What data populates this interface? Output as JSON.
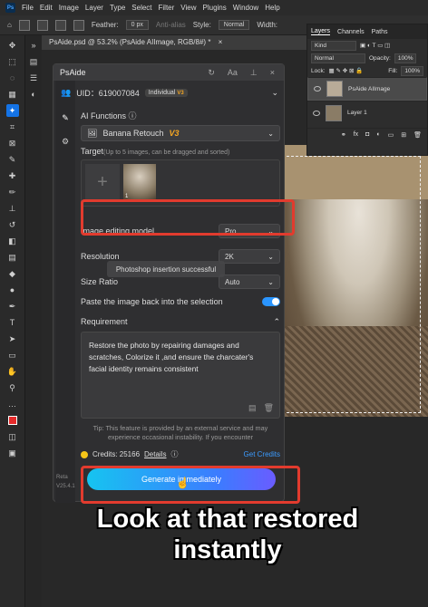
{
  "menubar": {
    "logo": "Ps",
    "items": [
      "File",
      "Edit",
      "Image",
      "Layer",
      "Type",
      "Select",
      "Filter",
      "View",
      "Plugins",
      "Window",
      "Help"
    ]
  },
  "options": {
    "feather_label": "Feather:",
    "feather_value": "0 px",
    "antialias": "Anti-alias",
    "style_label": "Style:",
    "style_value": "Normal",
    "width_label": "Width:"
  },
  "document": {
    "tab_title": "PsAide.psd @ 53.2% (PsAide AIImage, RGB/8#) *",
    "close": "×"
  },
  "layers": {
    "tabs": [
      "Layers",
      "Channels",
      "Paths"
    ],
    "kind": "Kind",
    "blend": "Normal",
    "opacity_label": "Opacity:",
    "opacity": "100%",
    "lock_label": "Lock:",
    "fill_label": "Fill:",
    "fill": "100%",
    "items": [
      {
        "name": "PsAide AIImage"
      },
      {
        "name": "Layer 1"
      }
    ],
    "bottom_icons": [
      "link",
      "fx",
      "mask",
      "adjust",
      "folder",
      "new",
      "trash"
    ]
  },
  "panel": {
    "title": "PsAide",
    "uid": "UID：619007084",
    "plan": "Individual",
    "plan_badge": "V3",
    "functions_label": "AI Functions",
    "function_value": "Banana Retouch",
    "function_version": "V3",
    "target_label": "Target",
    "target_hint": "(Up to 5 images, can be dragged and sorted)",
    "thumb_index": "1",
    "model_label": "Image editing model",
    "model_value": "Pro",
    "resolution_label": "Resolution",
    "resolution_value": "2K",
    "size_label": "Size Ratio",
    "size_value": "Auto",
    "toast": "Photoshop insertion successful",
    "paste_label": "Paste the image back into the selection",
    "paste_enabled": true,
    "requirement_label": "Requirement",
    "requirement_text": "Restore the photo by repairing damages and scratches, Colorize it ,and ensure the charcater's facial identity remains consistent",
    "tip": "Tip: This feature is provided by an external service and may experience occasional instability. If you encounter",
    "credits_label": "Credits: 25166",
    "details": "Details",
    "get_credits": "Get Credits",
    "generate": "Generate immediately",
    "version": "Reta\nV25.4.1"
  },
  "caption": {
    "line1": "Look at that restored",
    "line2": "instantly"
  },
  "colors": {
    "accent": "#1473e6",
    "highlight": "#e23b2e",
    "gold": "#f5a623",
    "link": "#3b9bff"
  }
}
